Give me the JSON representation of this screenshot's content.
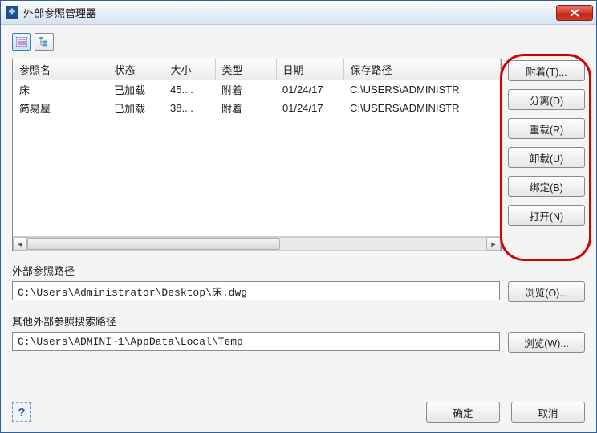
{
  "window": {
    "title": "外部参照管理器"
  },
  "table": {
    "headers": {
      "name": "参照名",
      "status": "状态",
      "size": "大小",
      "type": "类型",
      "date": "日期",
      "path": "保存路径"
    },
    "rows": [
      {
        "name": "床",
        "status": "已加载",
        "size": "45....",
        "type": "附着",
        "date": "01/24/17",
        "path": "C:\\USERS\\ADMINISTR"
      },
      {
        "name": "简易屋",
        "status": "已加载",
        "size": "38....",
        "type": "附着",
        "date": "01/24/17",
        "path": "C:\\USERS\\ADMINISTR"
      }
    ]
  },
  "side_buttons": {
    "attach": "附着(T)...",
    "detach": "分离(D)",
    "reload": "重载(R)",
    "unload": "卸载(U)",
    "bind": "绑定(B)",
    "open": "打开(N)"
  },
  "path1": {
    "label": "外部参照路径",
    "value": "C:\\Users\\Administrator\\Desktop\\床.dwg",
    "browse": "浏览(O)..."
  },
  "path2": {
    "label": "其他外部参照搜索路径",
    "value": "C:\\Users\\ADMINI~1\\AppData\\Local\\Temp",
    "browse": "浏览(W)..."
  },
  "footer": {
    "ok": "确定",
    "cancel": "取消"
  }
}
